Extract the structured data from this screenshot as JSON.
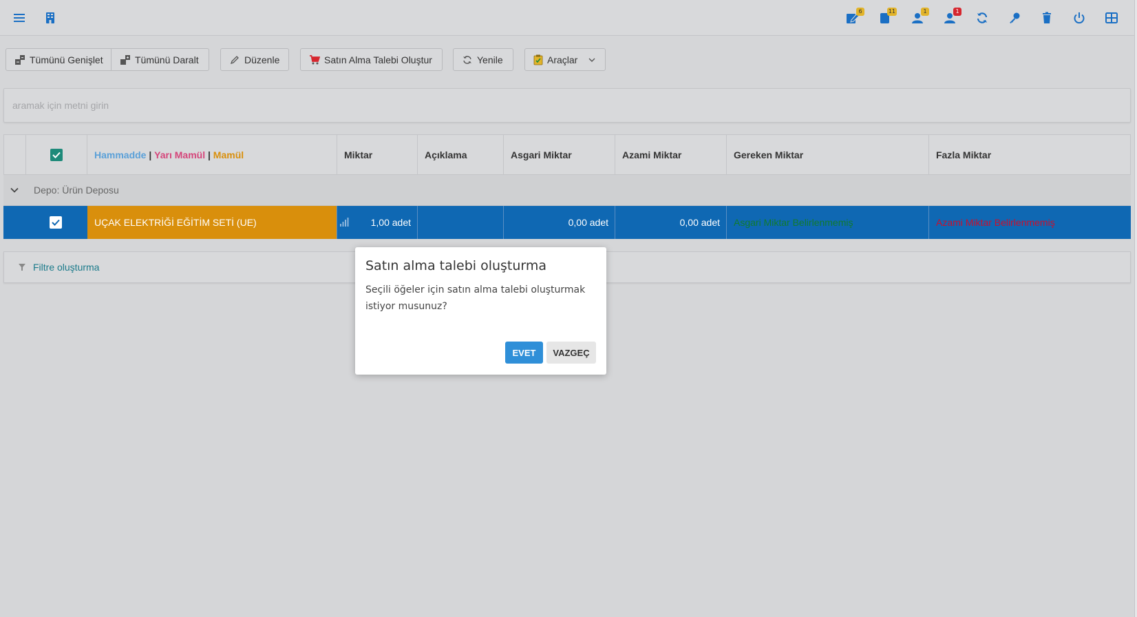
{
  "topbar": {
    "badges": {
      "edit": "6",
      "book": "11",
      "user": "1",
      "upload": "1"
    }
  },
  "toolbar": {
    "expand_all": "Tümünü Genişlet",
    "collapse_all": "Tümünü Daralt",
    "edit": "Düzenle",
    "purchase_request": "Satın Alma Talebi Oluştur",
    "refresh": "Yenile",
    "tools": "Araçlar"
  },
  "search": {
    "placeholder": "aramak için metni girin"
  },
  "grid": {
    "header": {
      "legend_raw": "Hammadde",
      "legend_sep1": " | ",
      "legend_semi": "Yarı Mamül",
      "legend_sep2": " | ",
      "legend_product": "Mamül",
      "miktar": "Miktar",
      "aciklama": "Açıklama",
      "asgari": "Asgari Miktar",
      "azami": "Azami Miktar",
      "gereken": "Gereken Miktar",
      "fazla": "Fazla Miktar"
    },
    "group": {
      "label": "Depo: Ürün Deposu"
    },
    "rows": [
      {
        "name": "UÇAK ELEKTRİĞİ EĞİTİM SETİ (UE)",
        "miktar": "1,00 adet",
        "aciklama": "",
        "asgari": "0,00 adet",
        "azami": "0,00 adet",
        "gereken": "Asgari Miktar Belirlenmemiş",
        "fazla": "Azami Miktar Belirlenmemiş"
      }
    ]
  },
  "filter": {
    "label": "Filtre oluşturma"
  },
  "dialog": {
    "title": "Satın alma talebi oluşturma",
    "message": "Seçili öğeler için satın alma talebi oluşturmak istiyor musunuz?",
    "yes": "EVET",
    "cancel": "VAZGEÇ"
  },
  "colors": {
    "accent": "#1a6fc4",
    "row_selected": "#0f68b3",
    "product_cell": "#d98f0c",
    "legend_raw": "#5aa0d8",
    "legend_semi": "#d5457a",
    "legend_product": "#d98f0c",
    "gereken_text": "#117a2e",
    "fazla_text": "#c8102e"
  }
}
